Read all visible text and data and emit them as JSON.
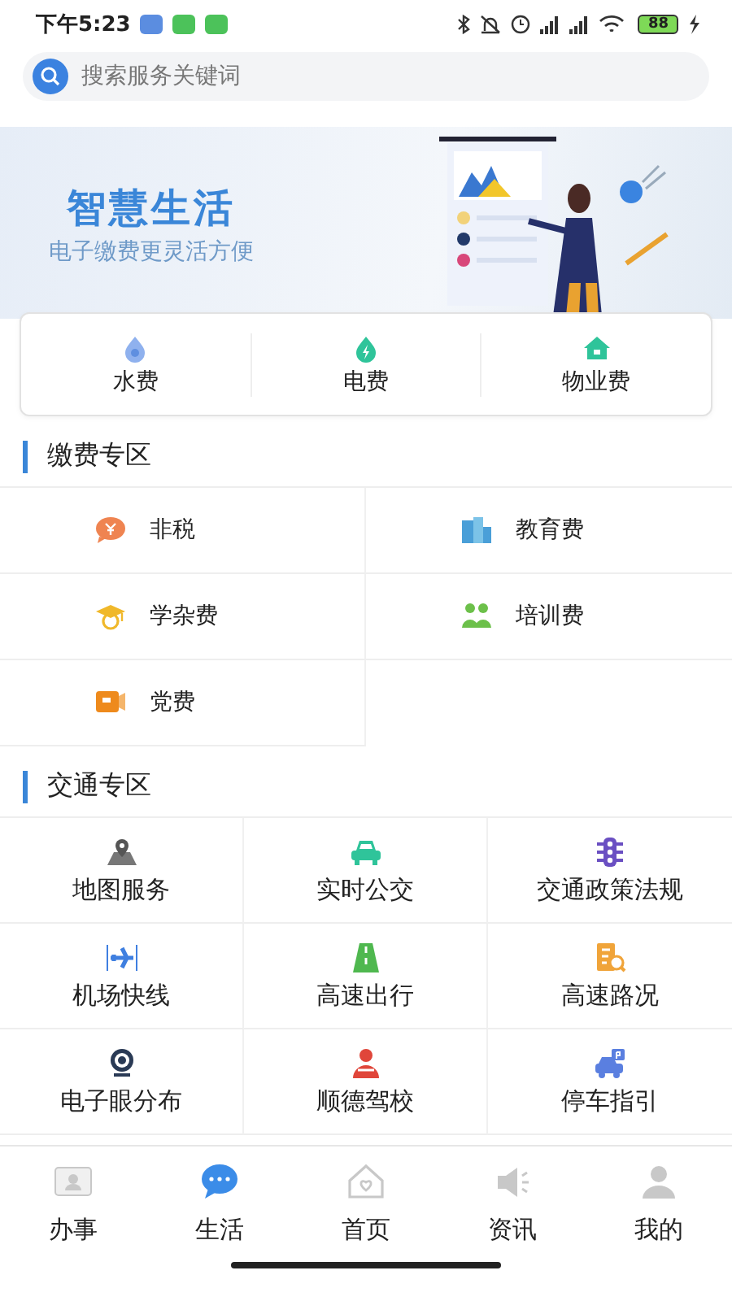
{
  "status_bar": {
    "time": "下午5:23",
    "battery": "88"
  },
  "search": {
    "placeholder": "搜索服务关键词"
  },
  "banner": {
    "title": "智慧生活",
    "subtitle": "电子缴费更灵活方便"
  },
  "quick_pay": [
    "水费",
    "电费",
    "物业费"
  ],
  "sections": [
    {
      "title": "缴费专区",
      "kind": "rows",
      "items": [
        "非税",
        "教育费",
        "学杂费",
        "培训费",
        "党费"
      ]
    },
    {
      "title": "交通专区",
      "kind": "tiles",
      "items": [
        "地图服务",
        "实时公交",
        "交通政策法规",
        "机场快线",
        "高速出行",
        "高速路况",
        "电子眼分布",
        "顺德驾校",
        "停车指引"
      ]
    }
  ],
  "tab_bar": [
    {
      "label": "办事",
      "selected": false
    },
    {
      "label": "生活",
      "selected": true
    },
    {
      "label": "首页",
      "selected": false
    },
    {
      "label": "资讯",
      "selected": false
    },
    {
      "label": "我的",
      "selected": false
    }
  ]
}
